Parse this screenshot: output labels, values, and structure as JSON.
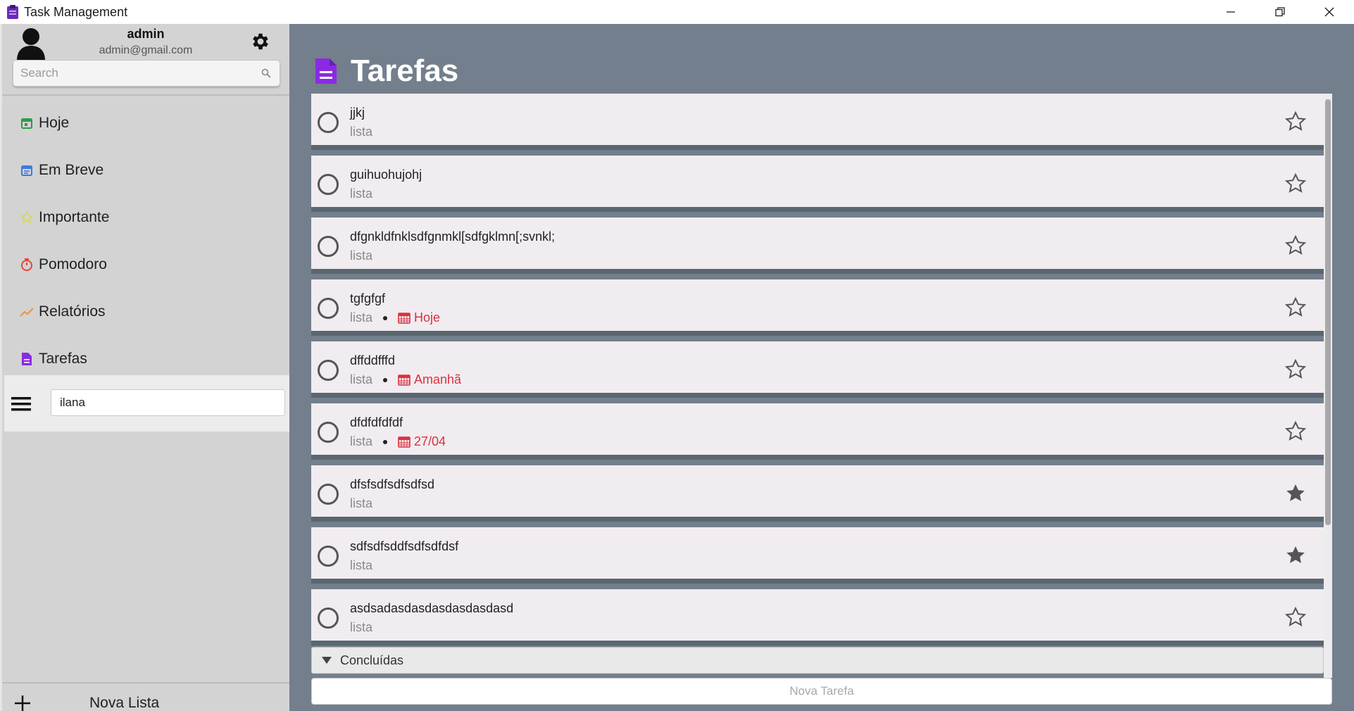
{
  "window": {
    "title": "Task Management",
    "app_icon": "clipboard-icon",
    "controls": [
      "minimize-icon",
      "restore-icon",
      "close-icon"
    ]
  },
  "user": {
    "name": "admin",
    "email": "admin@gmail.com"
  },
  "search": {
    "placeholder": "Search"
  },
  "nav": [
    {
      "label": "Hoje",
      "icon": "calendar-today-icon",
      "color": "#2e9b4b"
    },
    {
      "label": "Em Breve",
      "icon": "calendar-upcoming-icon",
      "color": "#3b7be0"
    },
    {
      "label": "Importante",
      "icon": "star-outline-icon",
      "color": "#d9d94a"
    },
    {
      "label": "Pomodoro",
      "icon": "timer-icon",
      "color": "#e0463a"
    },
    {
      "label": "Relatórios",
      "icon": "trend-icon",
      "color": "#f0953a"
    },
    {
      "label": "Tarefas",
      "icon": "document-icon",
      "color": "#8a2be2"
    }
  ],
  "list_editor": {
    "value": "ilana"
  },
  "new_list": {
    "label": "Nova Lista"
  },
  "main": {
    "title": "Tarefas",
    "title_icon_color": "#8a2be2"
  },
  "tasks": [
    {
      "title": "jjkj",
      "list": "lista",
      "due": "",
      "starred": false
    },
    {
      "title": "guihuohujohj",
      "list": "lista",
      "due": "",
      "starred": false
    },
    {
      "title": "dfgnkldfnklsdfgnmkl[sdfgklmn[;svnkl;",
      "list": "lista",
      "due": "",
      "starred": false
    },
    {
      "title": "tgfgfgf",
      "list": "lista",
      "due": "Hoje",
      "starred": false
    },
    {
      "title": "dffddfffd",
      "list": "lista",
      "due": "Amanhã",
      "starred": false
    },
    {
      "title": "dfdfdfdfdf",
      "list": "lista",
      "due": "27/04",
      "starred": false
    },
    {
      "title": "dfsfsdfsdfsdfsd",
      "list": "lista",
      "due": "",
      "starred": true
    },
    {
      "title": "sdfsdfsddfsdfsdfdsf",
      "list": "lista",
      "due": "",
      "starred": true
    },
    {
      "title": "asdsadasdasdasdasdasdasd",
      "list": "lista",
      "due": "",
      "starred": false
    }
  ],
  "completed_section": {
    "label": "Concluídas"
  },
  "new_task": {
    "placeholder": "Nova Tarefa"
  },
  "colors": {
    "due": "#d6333f",
    "accent": "#8a2be2"
  }
}
